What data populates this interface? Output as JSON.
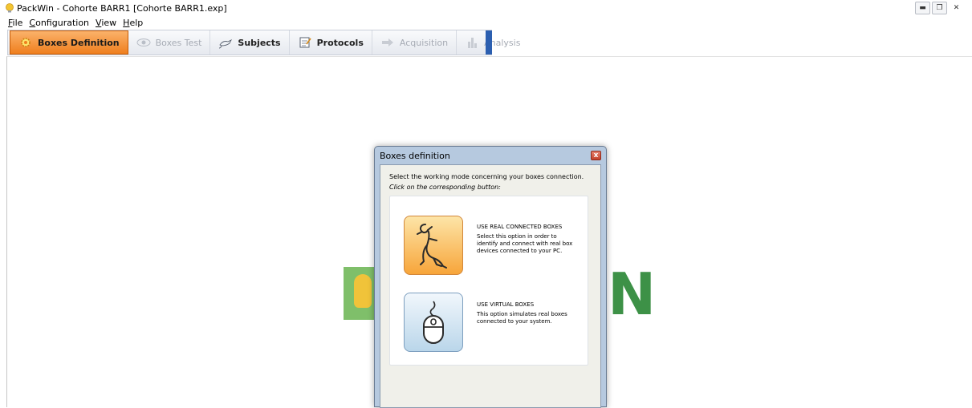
{
  "window": {
    "title": "PackWin - Cohorte BARR1 [Cohorte BARR1.exp]"
  },
  "menu": [
    {
      "label": "File",
      "accel": "F",
      "rest": "ile"
    },
    {
      "label": "Configuration",
      "accel": "C",
      "rest": "onfiguration"
    },
    {
      "label": "View",
      "accel": "V",
      "rest": "iew"
    },
    {
      "label": "Help",
      "accel": "H",
      "rest": "elp"
    }
  ],
  "toolbar": {
    "boxes_definition": "Boxes Definition",
    "boxes_test": "Boxes Test",
    "subjects": "Subjects",
    "protocols": "Protocols",
    "acquisition": "Acquisition",
    "analysis": "Analysis"
  },
  "background_logo": {
    "letter": "N"
  },
  "dialog": {
    "title": "Boxes definition",
    "close": "x",
    "instruction": "Select the working mode concerning your boxes connection.",
    "hint": "Click on the corresponding button:",
    "options": {
      "real": {
        "title": "USE REAL CONNECTED BOXES",
        "description": "Select this option in order to identify and connect with real box devices connected to your PC."
      },
      "virtual": {
        "title": "USE VIRTUAL BOXES",
        "description": "This option simulates real boxes connected to your system."
      }
    }
  },
  "colors": {
    "active_tool": "#ef7f1e",
    "dialog_frame": "#b6c9df",
    "logo_green": "#3d9147"
  }
}
